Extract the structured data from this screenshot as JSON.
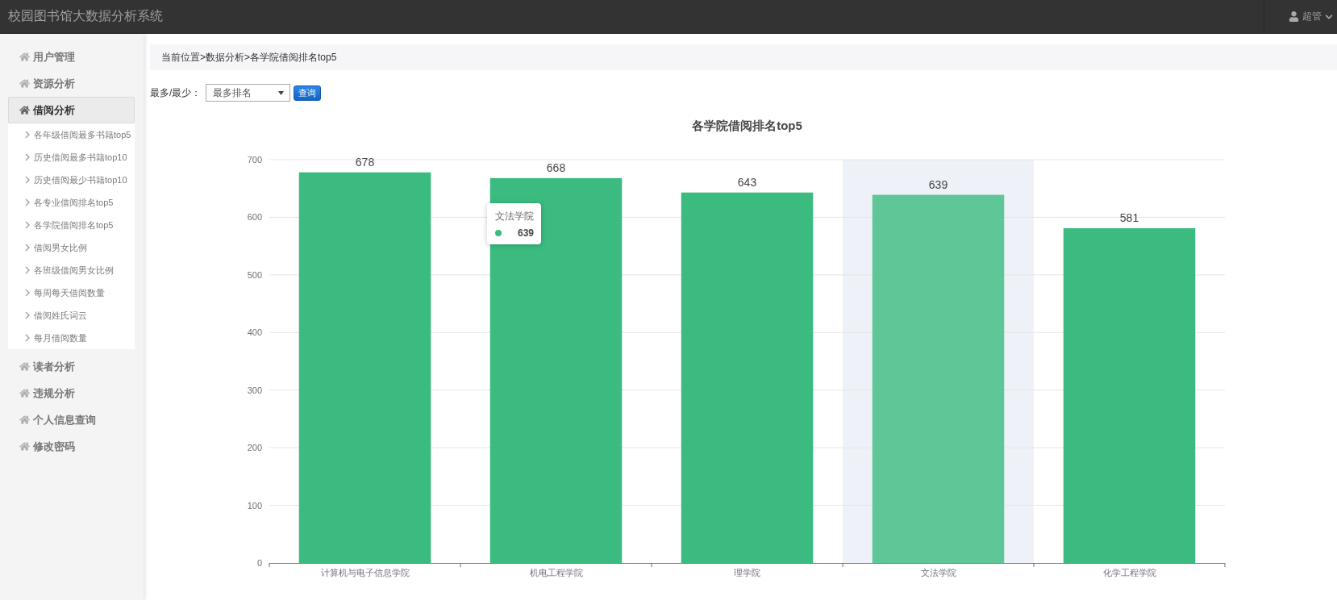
{
  "header": {
    "title": "校园图书馆大数据分析系统",
    "user": {
      "name": "超管"
    }
  },
  "sidebar": {
    "items": [
      {
        "label": "用户管理",
        "expanded": false
      },
      {
        "label": "资源分析",
        "expanded": false
      },
      {
        "label": "借阅分析",
        "expanded": true,
        "children": [
          {
            "label": "各年级借阅最多书籍top5",
            "selected": false
          },
          {
            "label": "历史借阅最多书籍top10",
            "selected": false
          },
          {
            "label": "历史借阅最少书籍top10",
            "selected": false
          },
          {
            "label": "各专业借阅排名top5",
            "selected": false
          },
          {
            "label": "各学院借阅排名top5",
            "selected": false
          },
          {
            "label": "借阅男女比例",
            "selected": false
          },
          {
            "label": "各班级借阅男女比例",
            "selected": false
          },
          {
            "label": "每周每天借阅数量",
            "selected": false
          },
          {
            "label": "借阅姓氏词云",
            "selected": false
          },
          {
            "label": "每月借阅数量",
            "selected": false
          }
        ]
      },
      {
        "label": "读者分析",
        "expanded": false
      },
      {
        "label": "违规分析",
        "expanded": false
      },
      {
        "label": "个人信息查询",
        "expanded": false
      },
      {
        "label": "修改密码",
        "expanded": false
      }
    ]
  },
  "breadcrumb": "当前位置>数据分析>各学院借阅排名top5",
  "query": {
    "label": "最多/最少：",
    "select": {
      "value": "最多排名"
    },
    "button": "查询"
  },
  "chart": {
    "chart_data": {
      "type": "bar",
      "title": "各学院借阅排名top5",
      "categories": [
        "计算机与电子信息学院",
        "机电工程学院",
        "理学院",
        "文法学院",
        "化学工程学院"
      ],
      "series": [
        {
          "color": "#3bbb7f",
          "values": [
            678,
            668,
            643,
            639,
            581
          ]
        }
      ],
      "ylim": [
        0,
        700
      ],
      "yticks": [
        0,
        100,
        200,
        300,
        400,
        500,
        600,
        700
      ],
      "grid": true,
      "data_labels": true
    },
    "bars": [
      {
        "hovered": false
      },
      {
        "hovered": false
      },
      {
        "hovered": false
      },
      {
        "hovered": true
      },
      {
        "hovered": false
      }
    ],
    "tooltip": {
      "title": "文法学院",
      "value": "639"
    }
  }
}
